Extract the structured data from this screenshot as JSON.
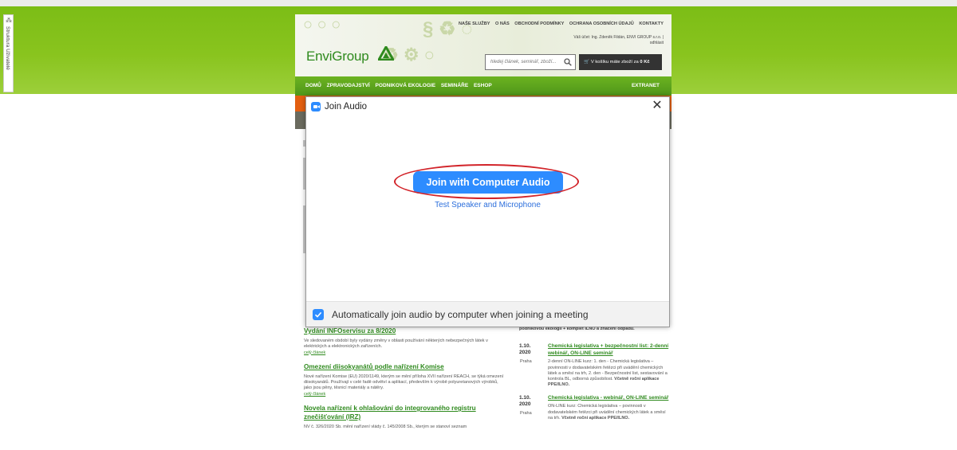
{
  "side_toolbar": {
    "labels": "Struktura  Uživatelé"
  },
  "site": {
    "logo": "EnviGroup",
    "top_nav": [
      "NAŠE SLUŽBY",
      "O NÁS",
      "OBCHODNÍ PODMÍNKY",
      "OCHRANA OSOBNÍCH ÚDAJŮ",
      "KONTAKTY"
    ],
    "login_line1": "Váš účet: Ing. Zdeněk Fildán, ENVI GROUP s.r.o. | odhlásit",
    "search_placeholder": "hledej článek, seminář, zboží...",
    "cart_text": "V košíku máte zboží za",
    "cart_amount": "0 Kč",
    "main_nav": [
      "DOMŮ",
      "ZPRAVODAJSTVÍ",
      "PODNIKOVÁ EKOLOGIE",
      "SEMINÁŘE",
      "ESHOP"
    ],
    "extranet": "EXTRANET"
  },
  "articles": [
    {
      "title": "Vydání INFOservisu za 8/2020",
      "text": "Ve sledovaném období byly vydány změny v oblasti používání některých nebezpečných látek v elektrických a elektronických zařízeních.",
      "more": "celý článek"
    },
    {
      "title": "Omezení diisokyanátů podle nařízení Komise",
      "text": "Nové nařízení Komise (EU) 2020/1149, kterým se mění příloha XVII nařízení REACH, se týká omezení diisokyanátů. Používají v celé řadě odvětví a aplikací, především k výrobě polyuretanových výrobků, jako jsou pěny, těsnicí materiály a nátěry.",
      "more": "celý článek"
    },
    {
      "title": "Novela nařízení k ohlašování do integrovaného registru znečišťování (IRZ)",
      "text": "NV č. 326/2020 Sb. mění nařízení vlády č. 145/2008 Sb., kterým se stanoví seznam",
      "more": ""
    }
  ],
  "events_top_text": "podnikovou ekologii + komplet ILNO a značení odpadů.",
  "events": [
    {
      "date_day": "1.10.",
      "date_year": "2020",
      "place": "Praha",
      "title": "Chemická legislativa + bezpečnostní list: 2-denní webinář, ON-LINE seminář",
      "text": "2-denní ON-LINE kurz: 1. den - Chemická legislativa – povinnosti v dodavatelském řetězci při uvádění chemických látek a směsí na trh, 2. den - Bezpečnostní list, sestavování a kontrola BL, odborná způsobilost.",
      "bold": "Včetně roční aplikace PPE/ILNO."
    },
    {
      "date_day": "1.10.",
      "date_year": "2020",
      "place": "Praha",
      "title": "Chemická legislativa - webinář, ON-LINE seminář",
      "text": "ON-LINE kurz: Chemická legislativa – povinnosti v dodavatelském řetězci při uvádění chemických látek a směsí na trh.",
      "bold": "Včetně roční aplikace PPE/ILNO."
    }
  ],
  "dialog": {
    "title": "Join Audio",
    "join_button": "Join with Computer Audio",
    "test_link": "Test Speaker and Microphone",
    "auto_join_label": "Automatically join audio by computer when joining a meeting",
    "auto_join_checked": true
  },
  "colors": {
    "zoom_blue": "#2d8cff",
    "site_green": "#2f8a1e",
    "annotation_red": "#d2242a",
    "background_green": "#89c41e"
  }
}
